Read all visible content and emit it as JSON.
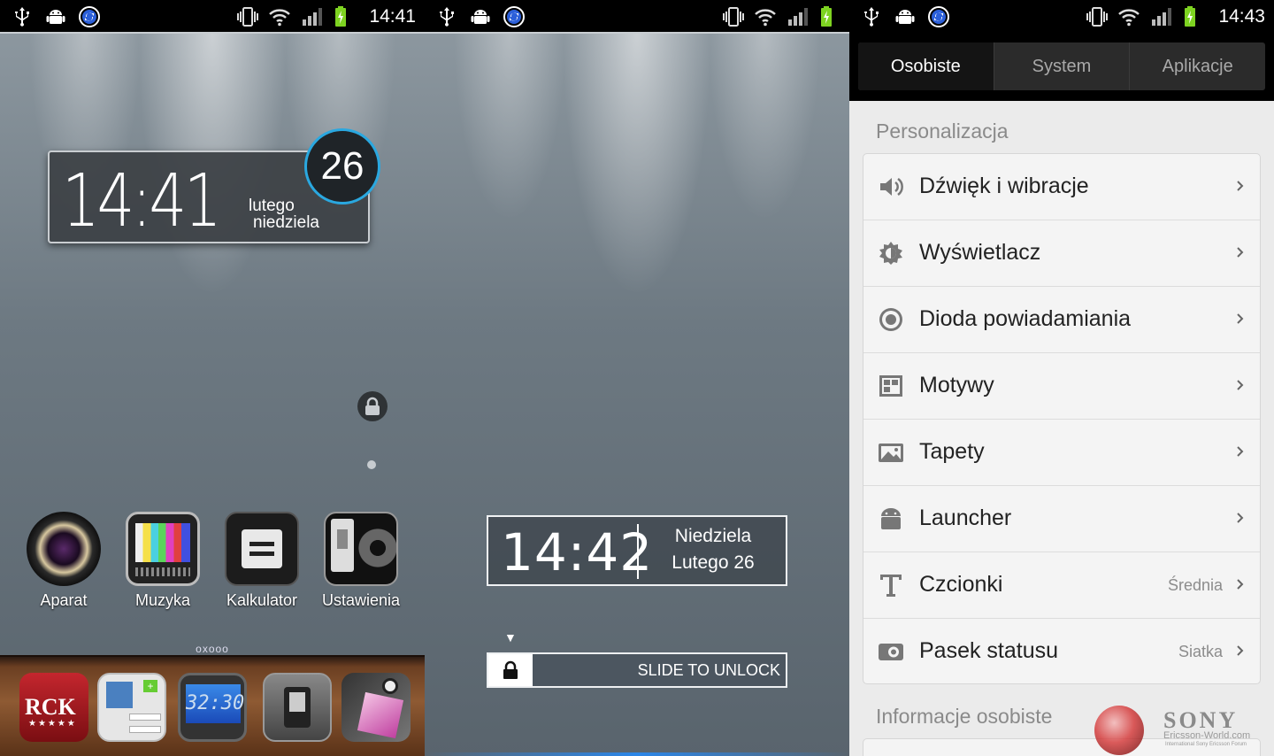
{
  "screens": {
    "home": {
      "status_time": "14:41",
      "clock_time": "14:41",
      "month": "lutego",
      "weekday": "niedziela",
      "day": "26",
      "apps": [
        {
          "label": "Aparat",
          "icon": "camera-lens-icon"
        },
        {
          "label": "Muzyka",
          "icon": "tv-music-icon"
        },
        {
          "label": "Kalkulator",
          "icon": "calculator-icon"
        },
        {
          "label": "Ustawienia",
          "icon": "settings-gear-icon"
        }
      ],
      "pager": "oxooo",
      "dock": [
        {
          "icon": "rock-radio-icon"
        },
        {
          "icon": "contacts-icon"
        },
        {
          "icon": "clock-app-icon"
        },
        {
          "icon": "switch-icon"
        },
        {
          "icon": "gallery-icon"
        }
      ]
    },
    "lock": {
      "clock_time": "14:42",
      "weekday": "Niedziela",
      "date": "Lutego 26",
      "slide_text": "SLIDE TO UNLOCK"
    },
    "settings": {
      "status_time": "14:43",
      "tabs": [
        "Osobiste",
        "System",
        "Aplikacje"
      ],
      "active_tab": 0,
      "section1": "Personalizacja",
      "items": [
        {
          "label": "Dźwięk i wibracje",
          "value": "",
          "icon": "speaker-icon"
        },
        {
          "label": "Wyświetlacz",
          "value": "",
          "icon": "brightness-icon"
        },
        {
          "label": "Dioda powiadamiania",
          "value": "",
          "icon": "led-icon"
        },
        {
          "label": "Motywy",
          "value": "",
          "icon": "themes-icon"
        },
        {
          "label": "Tapety",
          "value": "",
          "icon": "wallpaper-icon"
        },
        {
          "label": "Launcher",
          "value": "",
          "icon": "android-icon"
        },
        {
          "label": "Czcionki",
          "value": "Średnia",
          "icon": "font-icon"
        },
        {
          "label": "Pasek statusu",
          "value": "Siatka",
          "icon": "statusbar-icon"
        }
      ],
      "section2": "Informacje osobiste"
    }
  },
  "watermark": {
    "brand": "SONY",
    "site": "Ericsson-World.com",
    "tagline": "International Sony Ericsson Forum"
  },
  "colors": {
    "accent_blue": "#2aa8e0",
    "battery_green": "#7ed321",
    "settings_bg": "#ebebeb"
  }
}
